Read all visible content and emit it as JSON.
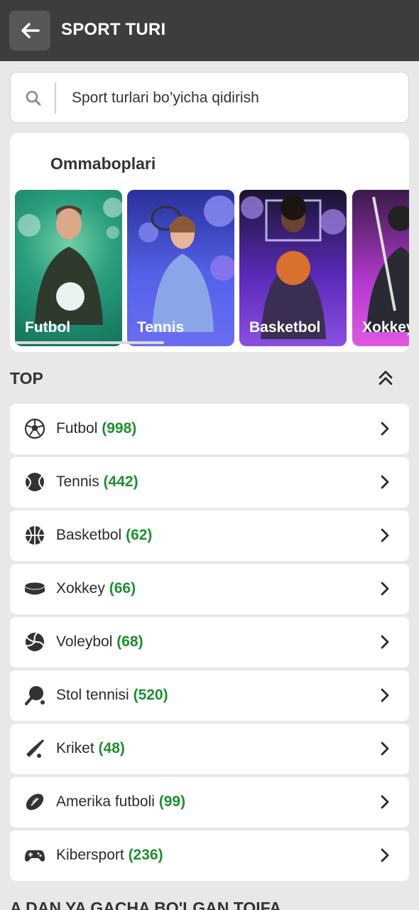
{
  "header": {
    "title": "SPORT TURI",
    "back_icon": "arrow-left-icon"
  },
  "search": {
    "placeholder": "Sport turlari bo’yicha qidirish",
    "icon": "search-icon"
  },
  "popular": {
    "title": "Ommaboplari",
    "cards": [
      {
        "label": "Futbol",
        "color": "#1f9b7a"
      },
      {
        "label": "Tennis",
        "color": "#5b5fe0"
      },
      {
        "label": "Basketbol",
        "color": "#7b3fd0"
      },
      {
        "label": "Xokkey",
        "color": "#c43bd8"
      }
    ]
  },
  "top": {
    "title": "TOP",
    "collapse_icon": "double-chevron-up-icon",
    "items": [
      {
        "label": "Futbol",
        "count": "(998)",
        "icon": "soccer-ball-icon"
      },
      {
        "label": "Tennis",
        "count": "(442)",
        "icon": "tennis-ball-icon"
      },
      {
        "label": "Basketbol",
        "count": "(62)",
        "icon": "basketball-icon"
      },
      {
        "label": "Xokkey",
        "count": "(66)",
        "icon": "hockey-puck-icon"
      },
      {
        "label": "Voleybol",
        "count": "(68)",
        "icon": "volleyball-icon"
      },
      {
        "label": "Stol tennisi",
        "count": "(520)",
        "icon": "ping-pong-icon"
      },
      {
        "label": "Kriket",
        "count": "(48)",
        "icon": "cricket-bat-icon"
      },
      {
        "label": "Amerika futboli",
        "count": "(99)",
        "icon": "american-football-icon"
      },
      {
        "label": "Kibersport",
        "count": "(236)",
        "icon": "gamepad-icon"
      }
    ]
  },
  "alphabet_section": {
    "title": "A DAN YA GACHA BO'LGAN TOIFA"
  },
  "colors": {
    "accent_green": "#1e8f2e",
    "header_bg": "#3d3d3d"
  }
}
